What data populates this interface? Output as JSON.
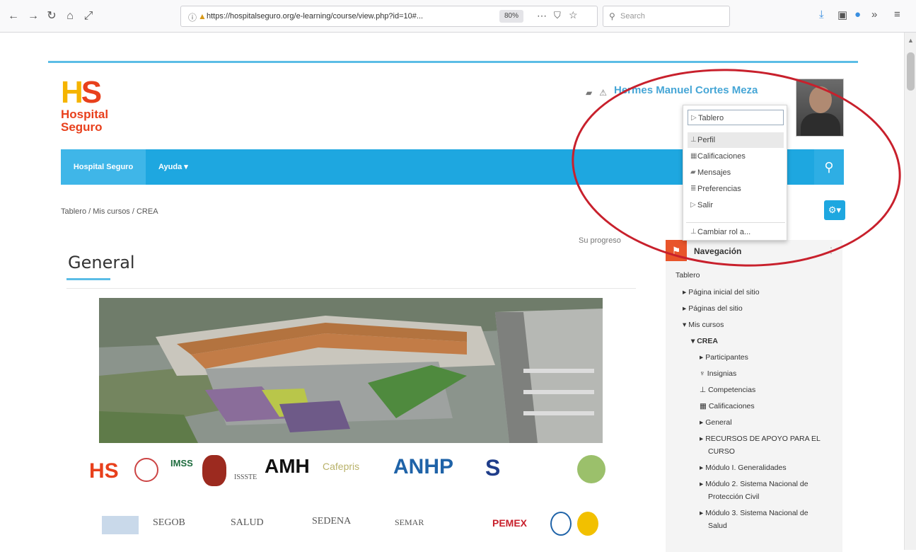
{
  "browser": {
    "url": "https://hospitalseguro.org/e-learning/course/view.php?id=10#...",
    "zoom": "80%",
    "more_glyph": "⋯",
    "search_placeholder": "Search"
  },
  "site": {
    "logo_letters_h": "H",
    "logo_letters_s": "S",
    "logo_line1": "Hospital",
    "logo_line2": "Seguro",
    "username": "Hermes Manuel Cortes Meza",
    "nav_home": "Hospital Seguro",
    "nav_help": "Ayuda ▾"
  },
  "user_menu": {
    "items": [
      {
        "label": "Tablero",
        "icon": "dashboard-icon"
      },
      {
        "label": "Perfil",
        "icon": "user-icon"
      },
      {
        "label": "Calificaciones",
        "icon": "grades-icon"
      },
      {
        "label": "Mensajes",
        "icon": "messages-icon"
      },
      {
        "label": "Preferencias",
        "icon": "preferences-icon"
      },
      {
        "label": "Salir",
        "icon": "logout-icon"
      },
      {
        "label": "Cambiar rol a...",
        "icon": "switch-role-icon"
      }
    ]
  },
  "breadcrumb": "Tablero / Mis cursos / CREA",
  "progress_label": "Su progreso",
  "section_title": "General",
  "navigation_block": {
    "title": "Navegación",
    "items": [
      {
        "label": "Tablero",
        "level": 0
      },
      {
        "label": "Página inicial del sitio",
        "level": 1
      },
      {
        "label": "Páginas del sitio",
        "level": 1
      },
      {
        "label": "Mis cursos",
        "level": 1
      },
      {
        "label": "CREA",
        "level": 2
      },
      {
        "label": "Participantes",
        "level": 3
      },
      {
        "label": "Insignias",
        "level": 3
      },
      {
        "label": "Competencias",
        "level": 3
      },
      {
        "label": "Calificaciones",
        "level": 3
      },
      {
        "label": "General",
        "level": 3
      },
      {
        "label": "RECURSOS DE APOYO PARA EL",
        "level": 3
      },
      {
        "label": "CURSO",
        "level": 4
      },
      {
        "label": "Módulo I. Generalidades",
        "level": 3
      },
      {
        "label": "Módulo 2. Sistema Nacional de",
        "level": 3
      },
      {
        "label": "Protección Civil",
        "level": 4
      },
      {
        "label": "Módulo 3. Sistema Nacional de",
        "level": 3
      },
      {
        "label": "Salud",
        "level": 4
      }
    ]
  },
  "sponsors": {
    "imss": "IMSS",
    "issste": "ISSSTE",
    "segob": "SEGOB",
    "salud": "SALUD",
    "sedena": "SEDENA",
    "semar": "SEMAR",
    "pemex": "PEMEX",
    "amh": "AMH",
    "anhp": "ANHP",
    "cafeteria": "Cafepris"
  },
  "colors": {
    "accent": "#1ea7e0",
    "brand_red": "#e8401c",
    "annotation": "#c8202c"
  }
}
